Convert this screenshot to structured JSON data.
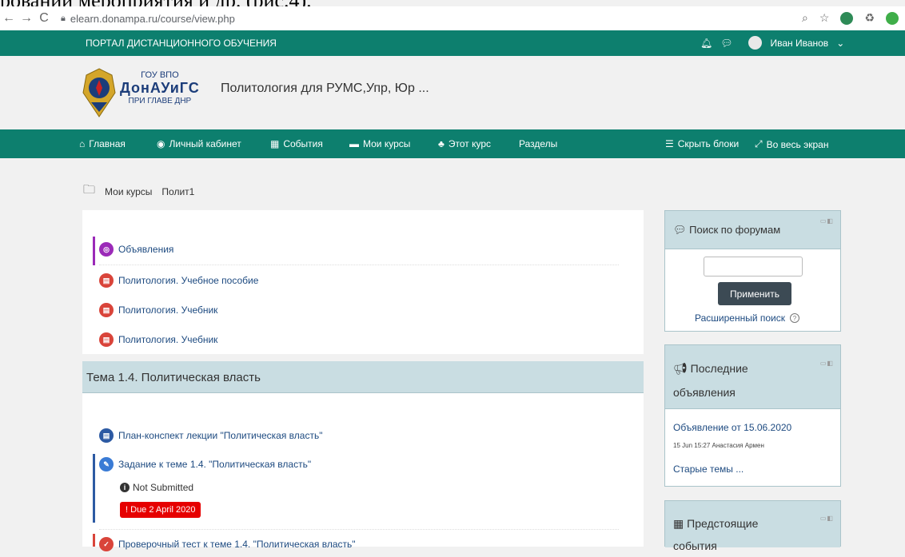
{
  "caption": {
    "text": "ровании мероприятия и др. (рис.4)."
  },
  "browser": {
    "back": "←",
    "forward": "→",
    "reload": "C",
    "url": "elearn.donampa.ru/course/view.php",
    "zoom_icon": "zoom-icon",
    "star_icon": "star-icon"
  },
  "topbar": {
    "portal_title": "ПОРТАЛ ДИСТАНЦИОННОГО ОБУЧЕНИЯ",
    "user_name": "Иван Иванов",
    "user_caret": "⌄"
  },
  "header": {
    "logo_line1": "ГОУ ВПО",
    "logo_line2": "ДонАУиГС",
    "logo_line3": "ПРИ ГЛАВЕ ДНР",
    "course_title": "Политология для РУМС,Упр, Юр ..."
  },
  "nav": {
    "items": [
      {
        "label": "Главная",
        "icon": "home-icon"
      },
      {
        "label": "Личный кабинет",
        "icon": "dashboard-icon"
      },
      {
        "label": "События",
        "icon": "calendar-icon"
      },
      {
        "label": "Мои курсы",
        "icon": "briefcase-icon"
      },
      {
        "label": "Этот курс",
        "icon": "sitemap-icon"
      },
      {
        "label": "Разделы",
        "icon": ""
      }
    ],
    "hide_blocks": "Скрыть блоки",
    "fullscreen": "Во весь экран"
  },
  "breadcrumb": {
    "item1": "Мои курсы",
    "item2": "Полит1"
  },
  "section1": {
    "activities": [
      {
        "label": "Объявления",
        "type": "forum"
      },
      {
        "label": "Политология. Учебное пособие",
        "type": "pdf"
      },
      {
        "label": "Политология. Учебник",
        "type": "pdf"
      },
      {
        "label": "Политология. Учебник",
        "type": "pdf"
      }
    ]
  },
  "topic": {
    "title": "Тема 1.4. Политическая власть",
    "activities": [
      {
        "label": "План-конспект лекции \"Политическая власть\"",
        "type": "doc"
      },
      {
        "label": "Задание к теме 1.4. \"Политическая власть\"",
        "type": "assign"
      },
      {
        "label": "Проверочный тест к теме 1.4. \"Политическая власть\"",
        "type": "quiz"
      }
    ],
    "status": "Not Submitted",
    "due": "Due 2 April 2020",
    "due_mark": "!"
  },
  "blocks": {
    "search": {
      "title": "Поиск по форумам",
      "apply": "Применить",
      "advanced": "Расширенный поиск",
      "help": "?"
    },
    "news": {
      "title_line1": "Последние",
      "title_line2": "объявления",
      "item_title": "Объявление от 15.06.2020",
      "item_meta": "15 Jun 15:27  Анастасия Армен",
      "older": "Старые темы ..."
    },
    "upcoming": {
      "title_line1": "Предстоящие",
      "title_line2": "события"
    }
  },
  "colors": {
    "brand_green": "#0d7f6e",
    "block_head": "#c9dde2",
    "forum_purple": "#9b2ab8",
    "pdf_red": "#d9443a",
    "doc_blue": "#2d5aa3",
    "due_red": "#e60000"
  }
}
